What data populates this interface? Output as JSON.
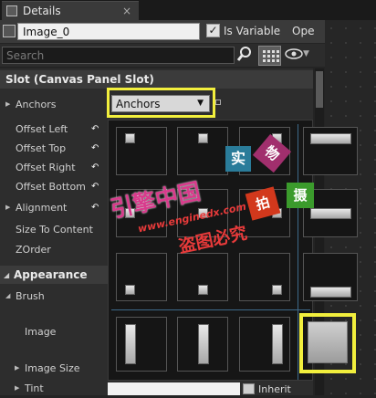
{
  "tab": {
    "title": "Details",
    "close": "×"
  },
  "name_row": {
    "name_value": "Image_0",
    "is_variable_label": "Is Variable",
    "is_variable_checked": "✓",
    "open_label": "Ope"
  },
  "search": {
    "placeholder": "Search"
  },
  "slot_section": {
    "title": "Slot (Canvas Panel Slot)"
  },
  "properties": [
    {
      "label": "Anchors"
    },
    {
      "label": "Offset Left"
    },
    {
      "label": "Offset Top"
    },
    {
      "label": "Offset Right"
    },
    {
      "label": "Offset Bottom"
    },
    {
      "label": "Alignment"
    },
    {
      "label": "Size To Content"
    },
    {
      "label": "ZOrder"
    }
  ],
  "anchors_dropdown": {
    "value": "Anchors"
  },
  "appearance_section": {
    "title": "Appearance"
  },
  "appearance_props": [
    {
      "label": "Brush"
    },
    {
      "label": "Image"
    },
    {
      "label": "Image Size"
    },
    {
      "label": "Tint"
    }
  ],
  "inherit": {
    "label": "Inherit"
  },
  "watermark": {
    "char1": "实",
    "char2": "物",
    "char3": "拍",
    "char4": "摄",
    "line1": "引擎中国",
    "line2": "www.enginedx.com",
    "line3": "盗图必究"
  },
  "colors": {
    "highlight": "#f2ef3d",
    "guide": "#3e6a8a",
    "panel": "#2d2d2d"
  }
}
